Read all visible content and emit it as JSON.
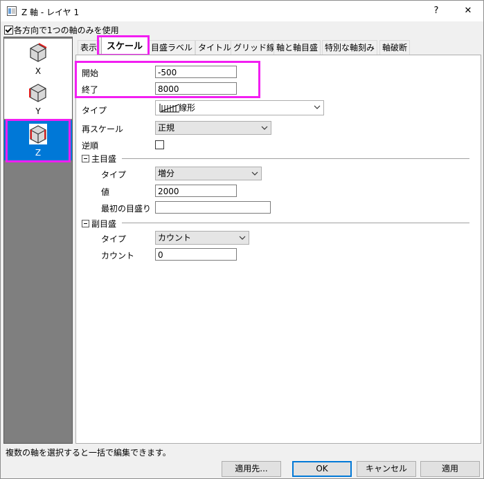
{
  "window": {
    "title": "Z 軸 - レイヤ 1",
    "help_label": "?",
    "close_label": "✕"
  },
  "use_one_axis": {
    "label": "各方向で1つの軸のみを使用",
    "checked": true
  },
  "axis_list": [
    {
      "label": "X",
      "icon": "axis-x-icon",
      "selected": false
    },
    {
      "label": "Y",
      "icon": "axis-y-icon",
      "selected": false
    },
    {
      "label": "Z",
      "icon": "axis-z-icon",
      "selected": true
    }
  ],
  "tabs": [
    {
      "label": "表示",
      "active": false
    },
    {
      "label": "スケール",
      "active": true
    },
    {
      "label": "目盛ラベル",
      "active": false
    },
    {
      "label": "タイトル",
      "active": false
    },
    {
      "label": "グリッド線",
      "active": false
    },
    {
      "label": "軸と軸目盛",
      "active": false
    },
    {
      "label": "特別な軸刻み",
      "active": false
    },
    {
      "label": "軸破断",
      "active": false
    }
  ],
  "scale": {
    "start_label": "開始",
    "start_value": "-500",
    "end_label": "終了",
    "end_value": "8000",
    "type_label": "タイプ",
    "type_value": "線形",
    "rescale_label": "再スケール",
    "rescale_value": "正規",
    "reverse_label": "逆順",
    "reverse_checked": false
  },
  "major_ticks": {
    "section_label": "主目盛",
    "type_label": "タイプ",
    "type_value": "増分",
    "value_label": "値",
    "value": "2000",
    "first_tick_label": "最初の目盛り",
    "first_tick_value": ""
  },
  "minor_ticks": {
    "section_label": "副目盛",
    "type_label": "タイプ",
    "type_value": "カウント",
    "count_label": "カウント",
    "count_value": "0"
  },
  "status_text": "複数の軸を選択すると一括で編集できます。",
  "buttons": {
    "apply_to": "適用先...",
    "ok": "OK",
    "cancel": "キャンセル",
    "apply": "適用"
  },
  "colors": {
    "highlight": "#f21ef2",
    "selection": "#0078d7"
  }
}
